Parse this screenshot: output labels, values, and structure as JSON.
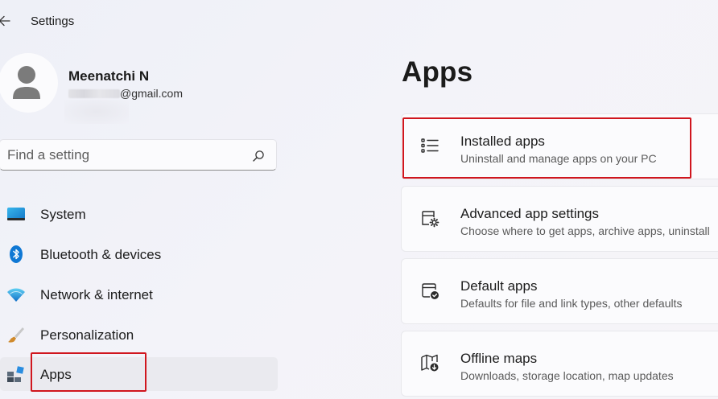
{
  "window": {
    "title": "Settings"
  },
  "profile": {
    "name": "Meenatchi N",
    "email_domain": "@gmail.com"
  },
  "search": {
    "placeholder": "Find a setting"
  },
  "nav": {
    "items": [
      {
        "label": "System",
        "icon": "system-icon"
      },
      {
        "label": "Bluetooth & devices",
        "icon": "bluetooth-icon"
      },
      {
        "label": "Network & internet",
        "icon": "wifi-icon"
      },
      {
        "label": "Personalization",
        "icon": "brush-icon"
      },
      {
        "label": "Apps",
        "icon": "apps-icon",
        "selected": true
      }
    ]
  },
  "main": {
    "title": "Apps",
    "cards": [
      {
        "title": "Installed apps",
        "description": "Uninstall and manage apps on your PC",
        "icon": "installed-apps-icon"
      },
      {
        "title": "Advanced app settings",
        "description": "Choose where to get apps, archive apps, uninstall",
        "icon": "advanced-app-settings-icon"
      },
      {
        "title": "Default apps",
        "description": "Defaults for file and link types, other defaults",
        "icon": "default-apps-icon"
      },
      {
        "title": "Offline maps",
        "description": "Downloads, storage location, map updates",
        "icon": "offline-maps-icon"
      }
    ]
  },
  "colors": {
    "highlight": "#d0161e",
    "accent": "#0078d4"
  }
}
